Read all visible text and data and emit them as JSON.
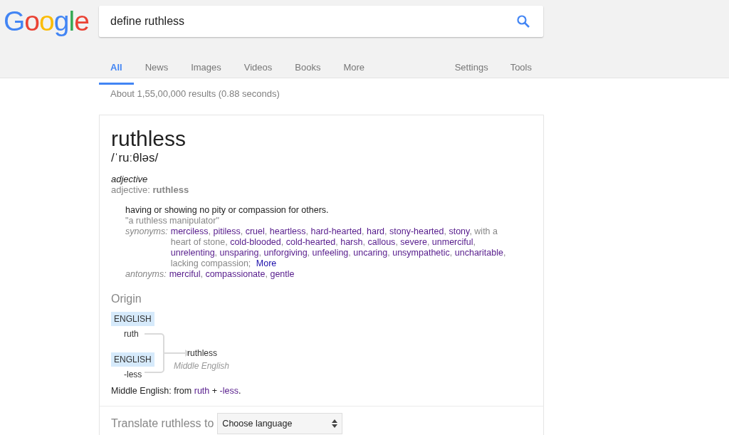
{
  "logo": {
    "text": "Google"
  },
  "search": {
    "value": "define ruthless"
  },
  "tabs": [
    {
      "label": "All",
      "selected": true
    },
    {
      "label": "News",
      "selected": false
    },
    {
      "label": "Images",
      "selected": false
    },
    {
      "label": "Videos",
      "selected": false
    },
    {
      "label": "Books",
      "selected": false
    },
    {
      "label": "More",
      "selected": false
    }
  ],
  "tools": [
    "Settings",
    "Tools"
  ],
  "result_stats": "About 1,55,00,000 results (0.88 seconds)",
  "definition": {
    "word": "ruthless",
    "phonetic": "/ˈruːθləs/",
    "part_of_speech": "adjective",
    "forms_label": "adjective: ",
    "forms_word": "ruthless",
    "sense": "having or showing no pity or compassion for others.",
    "example": "\"a ruthless manipulator\"",
    "separator": ",",
    "synonyms_label": "synonyms:",
    "synonyms": [
      {
        "text": "merciless",
        "kind": "link"
      },
      {
        "text": "pitiless",
        "kind": "link"
      },
      {
        "text": "cruel",
        "kind": "link"
      },
      {
        "text": "heartless",
        "kind": "link"
      },
      {
        "text": "hard-hearted",
        "kind": "link"
      },
      {
        "text": "hard",
        "kind": "link"
      },
      {
        "text": "stony-hearted",
        "kind": "link"
      },
      {
        "text": "stony",
        "kind": "link"
      },
      {
        "text": "with a",
        "kind": "plain"
      },
      {
        "text": "heart of stone",
        "kind": "plain"
      },
      {
        "text": "cold-blooded",
        "kind": "link"
      },
      {
        "text": "cold-hearted",
        "kind": "link"
      },
      {
        "text": "harsh",
        "kind": "link"
      },
      {
        "text": "callous",
        "kind": "link"
      },
      {
        "text": "severe",
        "kind": "link"
      },
      {
        "text": "unmerciful",
        "kind": "link"
      },
      {
        "text": "unrelenting",
        "kind": "link"
      },
      {
        "text": "unsparing",
        "kind": "link"
      },
      {
        "text": "unforgiving",
        "kind": "link"
      },
      {
        "text": "unfeeling",
        "kind": "link"
      },
      {
        "text": "uncaring",
        "kind": "link"
      },
      {
        "text": "unsympathetic",
        "kind": "link"
      },
      {
        "text": "uncharitable",
        "kind": "link"
      },
      {
        "text": "lacking compassion;",
        "kind": "plain"
      }
    ],
    "synonyms_more": "More",
    "antonyms_label": "antonyms:",
    "antonyms": [
      {
        "text": "merciful",
        "kind": "link"
      },
      {
        "text": "compassionate",
        "kind": "link"
      },
      {
        "text": "gentle",
        "kind": "link"
      }
    ]
  },
  "origin": {
    "heading": "Origin",
    "sources": [
      {
        "language": "ENGLISH",
        "word": "ruth"
      },
      {
        "language": "ENGLISH",
        "word": "-less"
      }
    ],
    "result": {
      "word": "ruthless",
      "language": "Middle English"
    },
    "etymology": [
      {
        "text": "Middle English: from ",
        "kind": "text"
      },
      {
        "text": "ruth",
        "kind": "link"
      },
      {
        "text": " + ",
        "kind": "text"
      },
      {
        "text": "-less",
        "kind": "link"
      },
      {
        "text": ".",
        "kind": "text"
      }
    ]
  },
  "translate": {
    "label": "Translate ruthless to",
    "select": "Choose language"
  }
}
